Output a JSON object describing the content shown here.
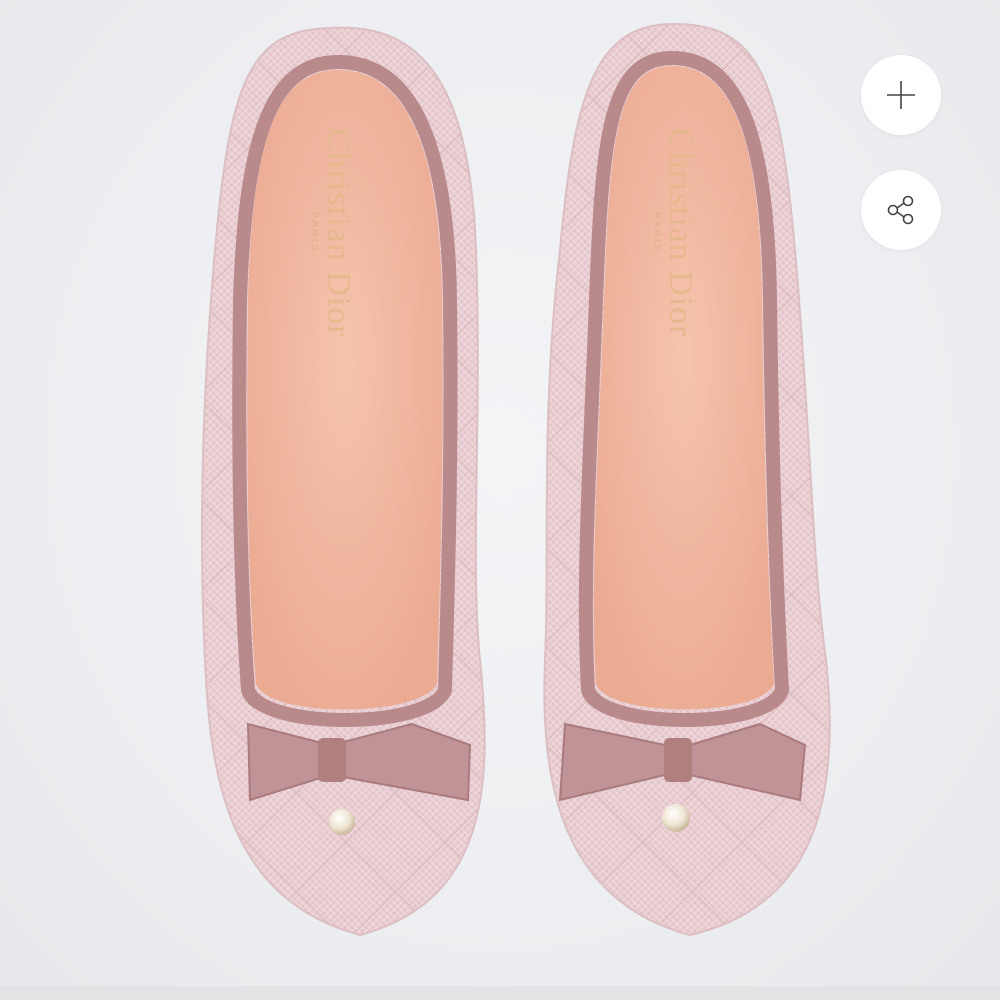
{
  "product": {
    "brand_line1": "Christian Dior",
    "brand_line2": "PARIS"
  },
  "actions": {
    "add_icon": "plus-icon",
    "share_icon": "share-icon"
  },
  "colors": {
    "upper": "#e8ccd0",
    "trim": "#b98a8c",
    "insole": "#f0b7a0",
    "pearl": "#efe7d6"
  }
}
